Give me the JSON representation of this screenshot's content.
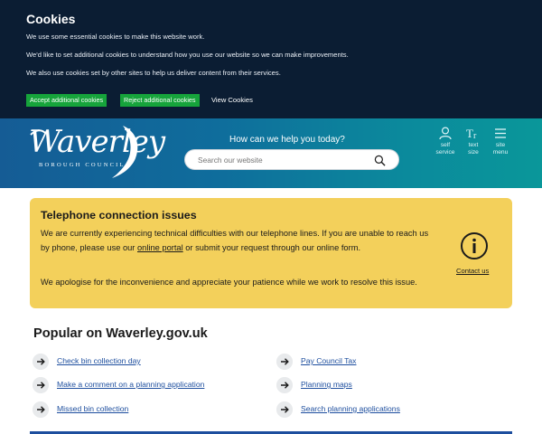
{
  "cookie": {
    "title": "Cookies",
    "text1": "We use some essential cookies to make this website work.",
    "text2": "We'd like to set additional cookies to understand how you use our website so we can make improvements.",
    "text3": "We also use cookies set by other sites to help us deliver content from their services.",
    "accept_label": "Accept additional cookies",
    "reject_label": "Reject additional cookies",
    "view_label": "View Cookies"
  },
  "header": {
    "logo_word": "Waverley",
    "logo_sub": "BOROUGH COUNCIL",
    "help_text": "How can we help you today?",
    "search_placeholder": "Search our website",
    "tools": [
      {
        "icon": "person-icon",
        "line1": "self",
        "line2": "service"
      },
      {
        "icon": "text-size-icon",
        "line1": "text",
        "line2": "size"
      },
      {
        "icon": "hamburger-menu-icon",
        "line1": "site",
        "line2": "menu"
      }
    ]
  },
  "alert": {
    "title": "Telephone connection issues",
    "p1_start": "We are currently experiencing technical difficulties with our telephone lines. If you are unable to reach us by phone, please use our ",
    "p1_link": "online portal",
    "p1_end": " or submit your request through our online form.",
    "p2": "We apologise for the inconvenience and appreciate your patience while we work to resolve this issue.",
    "contact_label": "Contact us",
    "icon": "info-icon"
  },
  "popular": {
    "title": "Popular on Waverley.gov.uk",
    "left": [
      "Check bin collection day",
      "Make a comment on a planning application",
      "Missed bin collection"
    ],
    "right": [
      "Pay Council Tax",
      "Planning maps",
      "Search planning applications"
    ]
  },
  "colors": {
    "cookie_bg": "#0b1d33",
    "cookie_button": "#16a43b",
    "alert_bg": "#f3d05b",
    "link": "#1d4e9e"
  }
}
